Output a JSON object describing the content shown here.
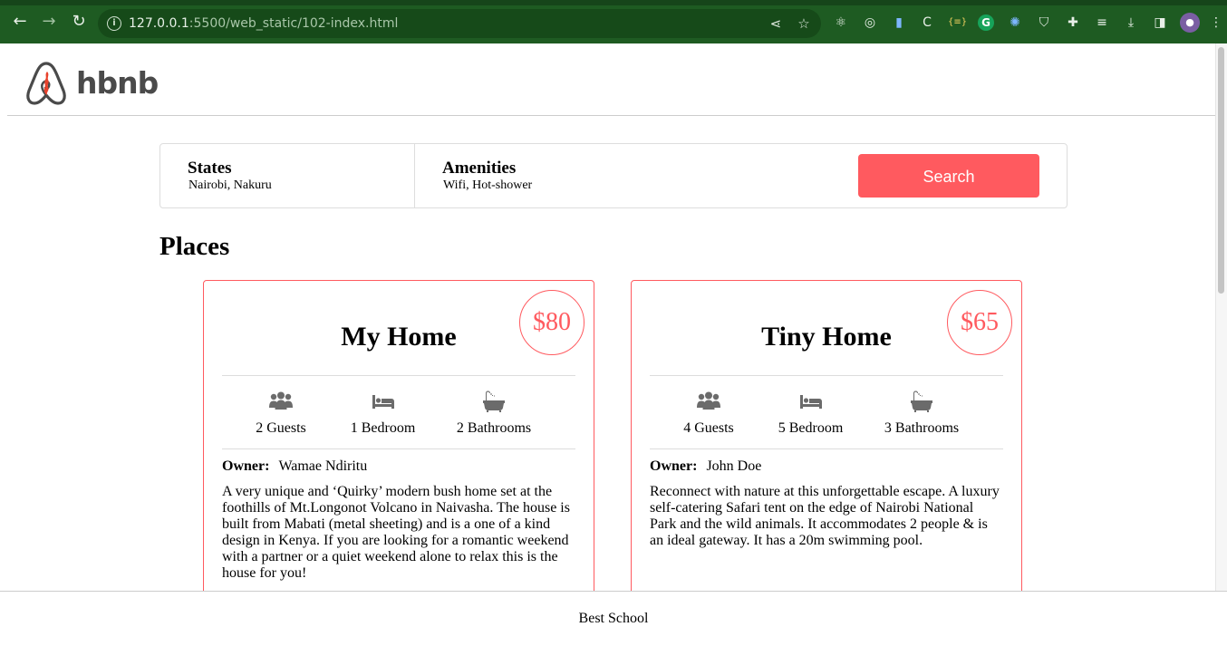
{
  "browser": {
    "url_host": "127.0.0.1",
    "url_rest": ":5500/web_static/102-index.html",
    "extensions_initials": "C",
    "grammarly_letter": "G",
    "json_badge": "{≡}"
  },
  "header": {
    "logo_text": "hbnb"
  },
  "filters": {
    "states": {
      "title": "States",
      "value": "Nairobi, Nakuru"
    },
    "amenities": {
      "title": "Amenities",
      "value": "Wifi, Hot-shower"
    },
    "search_label": "Search"
  },
  "places": {
    "title": "Places",
    "items": [
      {
        "name": "My Home",
        "price": "$80",
        "guests": "2 Guests",
        "bedrooms": "1 Bedroom",
        "bathrooms": "2 Bathrooms",
        "owner_label": "Owner:",
        "owner": "Wamae Ndiritu",
        "description": "A very unique and ‘Quirky’ modern bush home set at the foothills of Mt.Longonot Volcano in Naivasha. The house is built from Mabati (metal sheeting) and is a one of a kind design in Kenya. If you are looking for a romantic weekend with a partner or a quiet weekend alone to relax this is the house for you!"
      },
      {
        "name": "Tiny Home",
        "price": "$65",
        "guests": "4 Guests",
        "bedrooms": "5 Bedroom",
        "bathrooms": "3 Bathrooms",
        "owner_label": "Owner:",
        "owner": "John Doe",
        "description": "Reconnect with nature at this unforgettable escape. A luxury self-catering Safari tent on the edge of Nairobi National Park and the wild animals. It accommodates 2 people & is an ideal gateway. It has a 20m swimming pool."
      }
    ]
  },
  "footer": {
    "text": "Best School"
  },
  "colors": {
    "accent": "#ff5a5f",
    "chrome": "#1e5b22",
    "icon": "#6b6b6b"
  }
}
